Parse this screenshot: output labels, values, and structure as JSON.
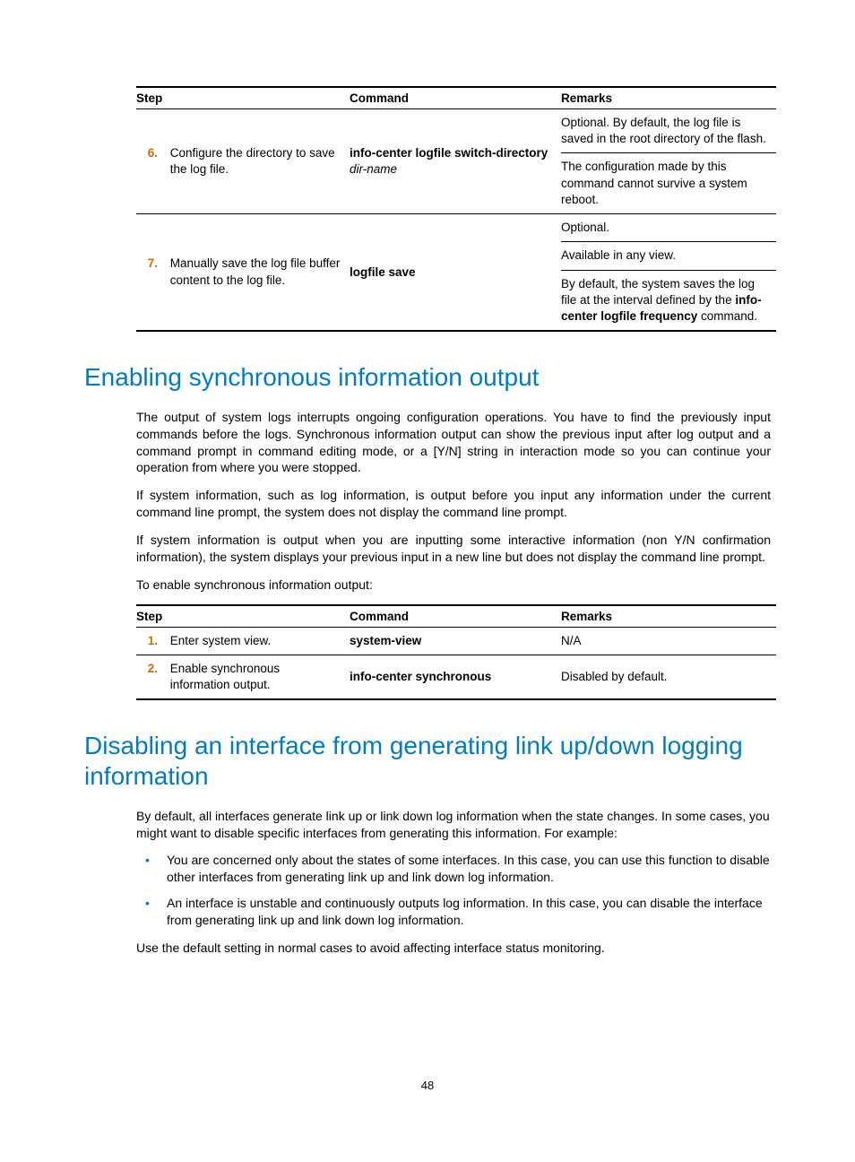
{
  "table1": {
    "headers": {
      "step": "Step",
      "command": "Command",
      "remarks": "Remarks"
    },
    "row6": {
      "num": "6.",
      "step": "Configure the directory to save the log file.",
      "cmd_bold": "info-center logfile switch-directory",
      "cmd_arg": "dir-name",
      "rem1": "Optional. By default, the log file is saved in the root directory of the flash.",
      "rem2": "The configuration made by this command cannot survive a system reboot."
    },
    "row7": {
      "num": "7.",
      "step": "Manually save the log file buffer content to the log file.",
      "cmd_bold": "logfile save",
      "rem1": "Optional.",
      "rem2": "Available in any view.",
      "rem3a": "By default, the system saves the log file at the interval defined by the ",
      "rem3b": "info-center logfile frequency",
      "rem3c": " command."
    }
  },
  "h1a": "Enabling synchronous information output",
  "p1": "The output of system logs interrupts ongoing configuration operations. You have to find the previously input commands before the logs. Synchronous information output can show the previous input after log output and a command prompt in command editing mode, or a [Y/N] string in interaction mode so you can continue your operation from where you were stopped.",
  "p2": "If system information, such as log information, is output before you input any information under the current command line prompt, the system does not display the command line prompt.",
  "p3": "If system information is output when you are inputting some interactive information (non Y/N confirmation information), the system displays your previous input in a new line but does not display the command line prompt.",
  "p4": "To enable synchronous information output:",
  "table2": {
    "headers": {
      "step": "Step",
      "command": "Command",
      "remarks": "Remarks"
    },
    "row1": {
      "num": "1.",
      "step": "Enter system view.",
      "cmd": "system-view",
      "rem": "N/A"
    },
    "row2": {
      "num": "2.",
      "step": "Enable synchronous information output.",
      "cmd": "info-center synchronous",
      "rem": "Disabled by default."
    }
  },
  "h1b": "Disabling an interface from generating link up/down logging information",
  "p5": "By default, all interfaces generate link up or link down log information when the state changes. In some cases, you might want to disable specific interfaces from generating this information. For example:",
  "li1": "You are concerned only about the states of some interfaces. In this case, you can use this function to disable other interfaces from generating link up and link down log information.",
  "li2": "An interface is unstable and continuously outputs log information. In this case, you can disable the interface from generating link up and link down log information.",
  "p6": "Use the default setting in normal cases to avoid affecting interface status monitoring.",
  "pagenum": "48"
}
